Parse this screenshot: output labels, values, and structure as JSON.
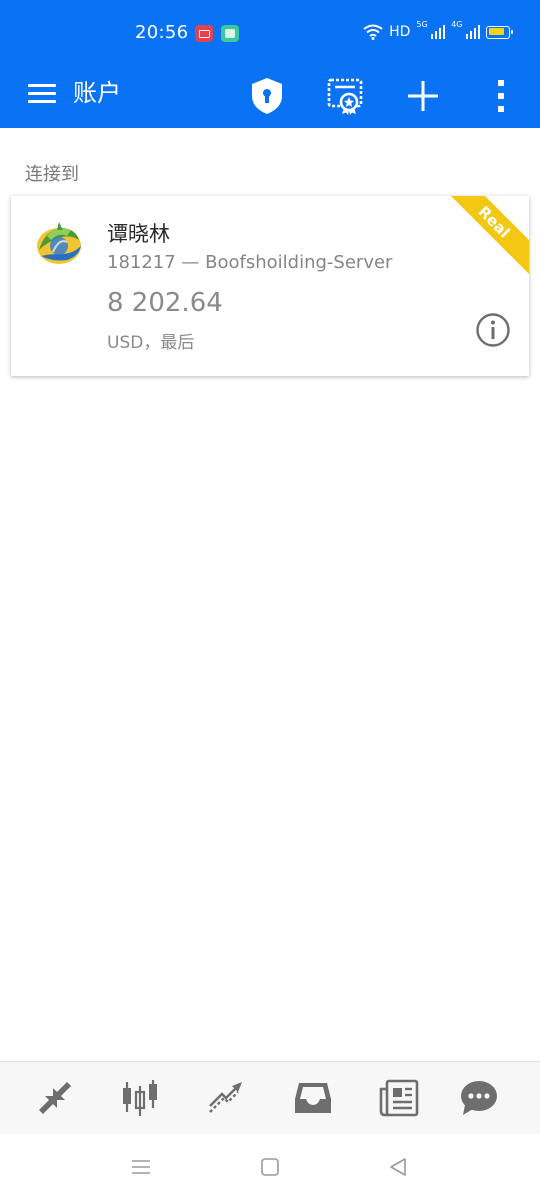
{
  "status_bar": {
    "time": "20:56",
    "network_label": "HD",
    "signal1_label": "5G",
    "signal2_label": "4G"
  },
  "app_bar": {
    "title": "账户",
    "actions": [
      "shield-icon",
      "certificate-icon",
      "add-icon",
      "more-vert-icon"
    ]
  },
  "section": {
    "connected_label": "连接到"
  },
  "account": {
    "name": "谭晓林",
    "server": "181217 — Boofshoilding-Server",
    "balance": "8 202.64",
    "currency_line": "USD，最后",
    "badge": "Real"
  },
  "bottom_nav": {
    "items": [
      "quotes-icon",
      "chart-icon",
      "trade-icon",
      "history-icon",
      "news-icon",
      "chat-icon"
    ]
  },
  "system_nav": {
    "items": [
      "menu-icon",
      "home-icon",
      "back-icon"
    ]
  },
  "colors": {
    "primary": "#0a73f5",
    "ribbon": "#f4c712",
    "icon_gray": "#6e6e6e"
  }
}
